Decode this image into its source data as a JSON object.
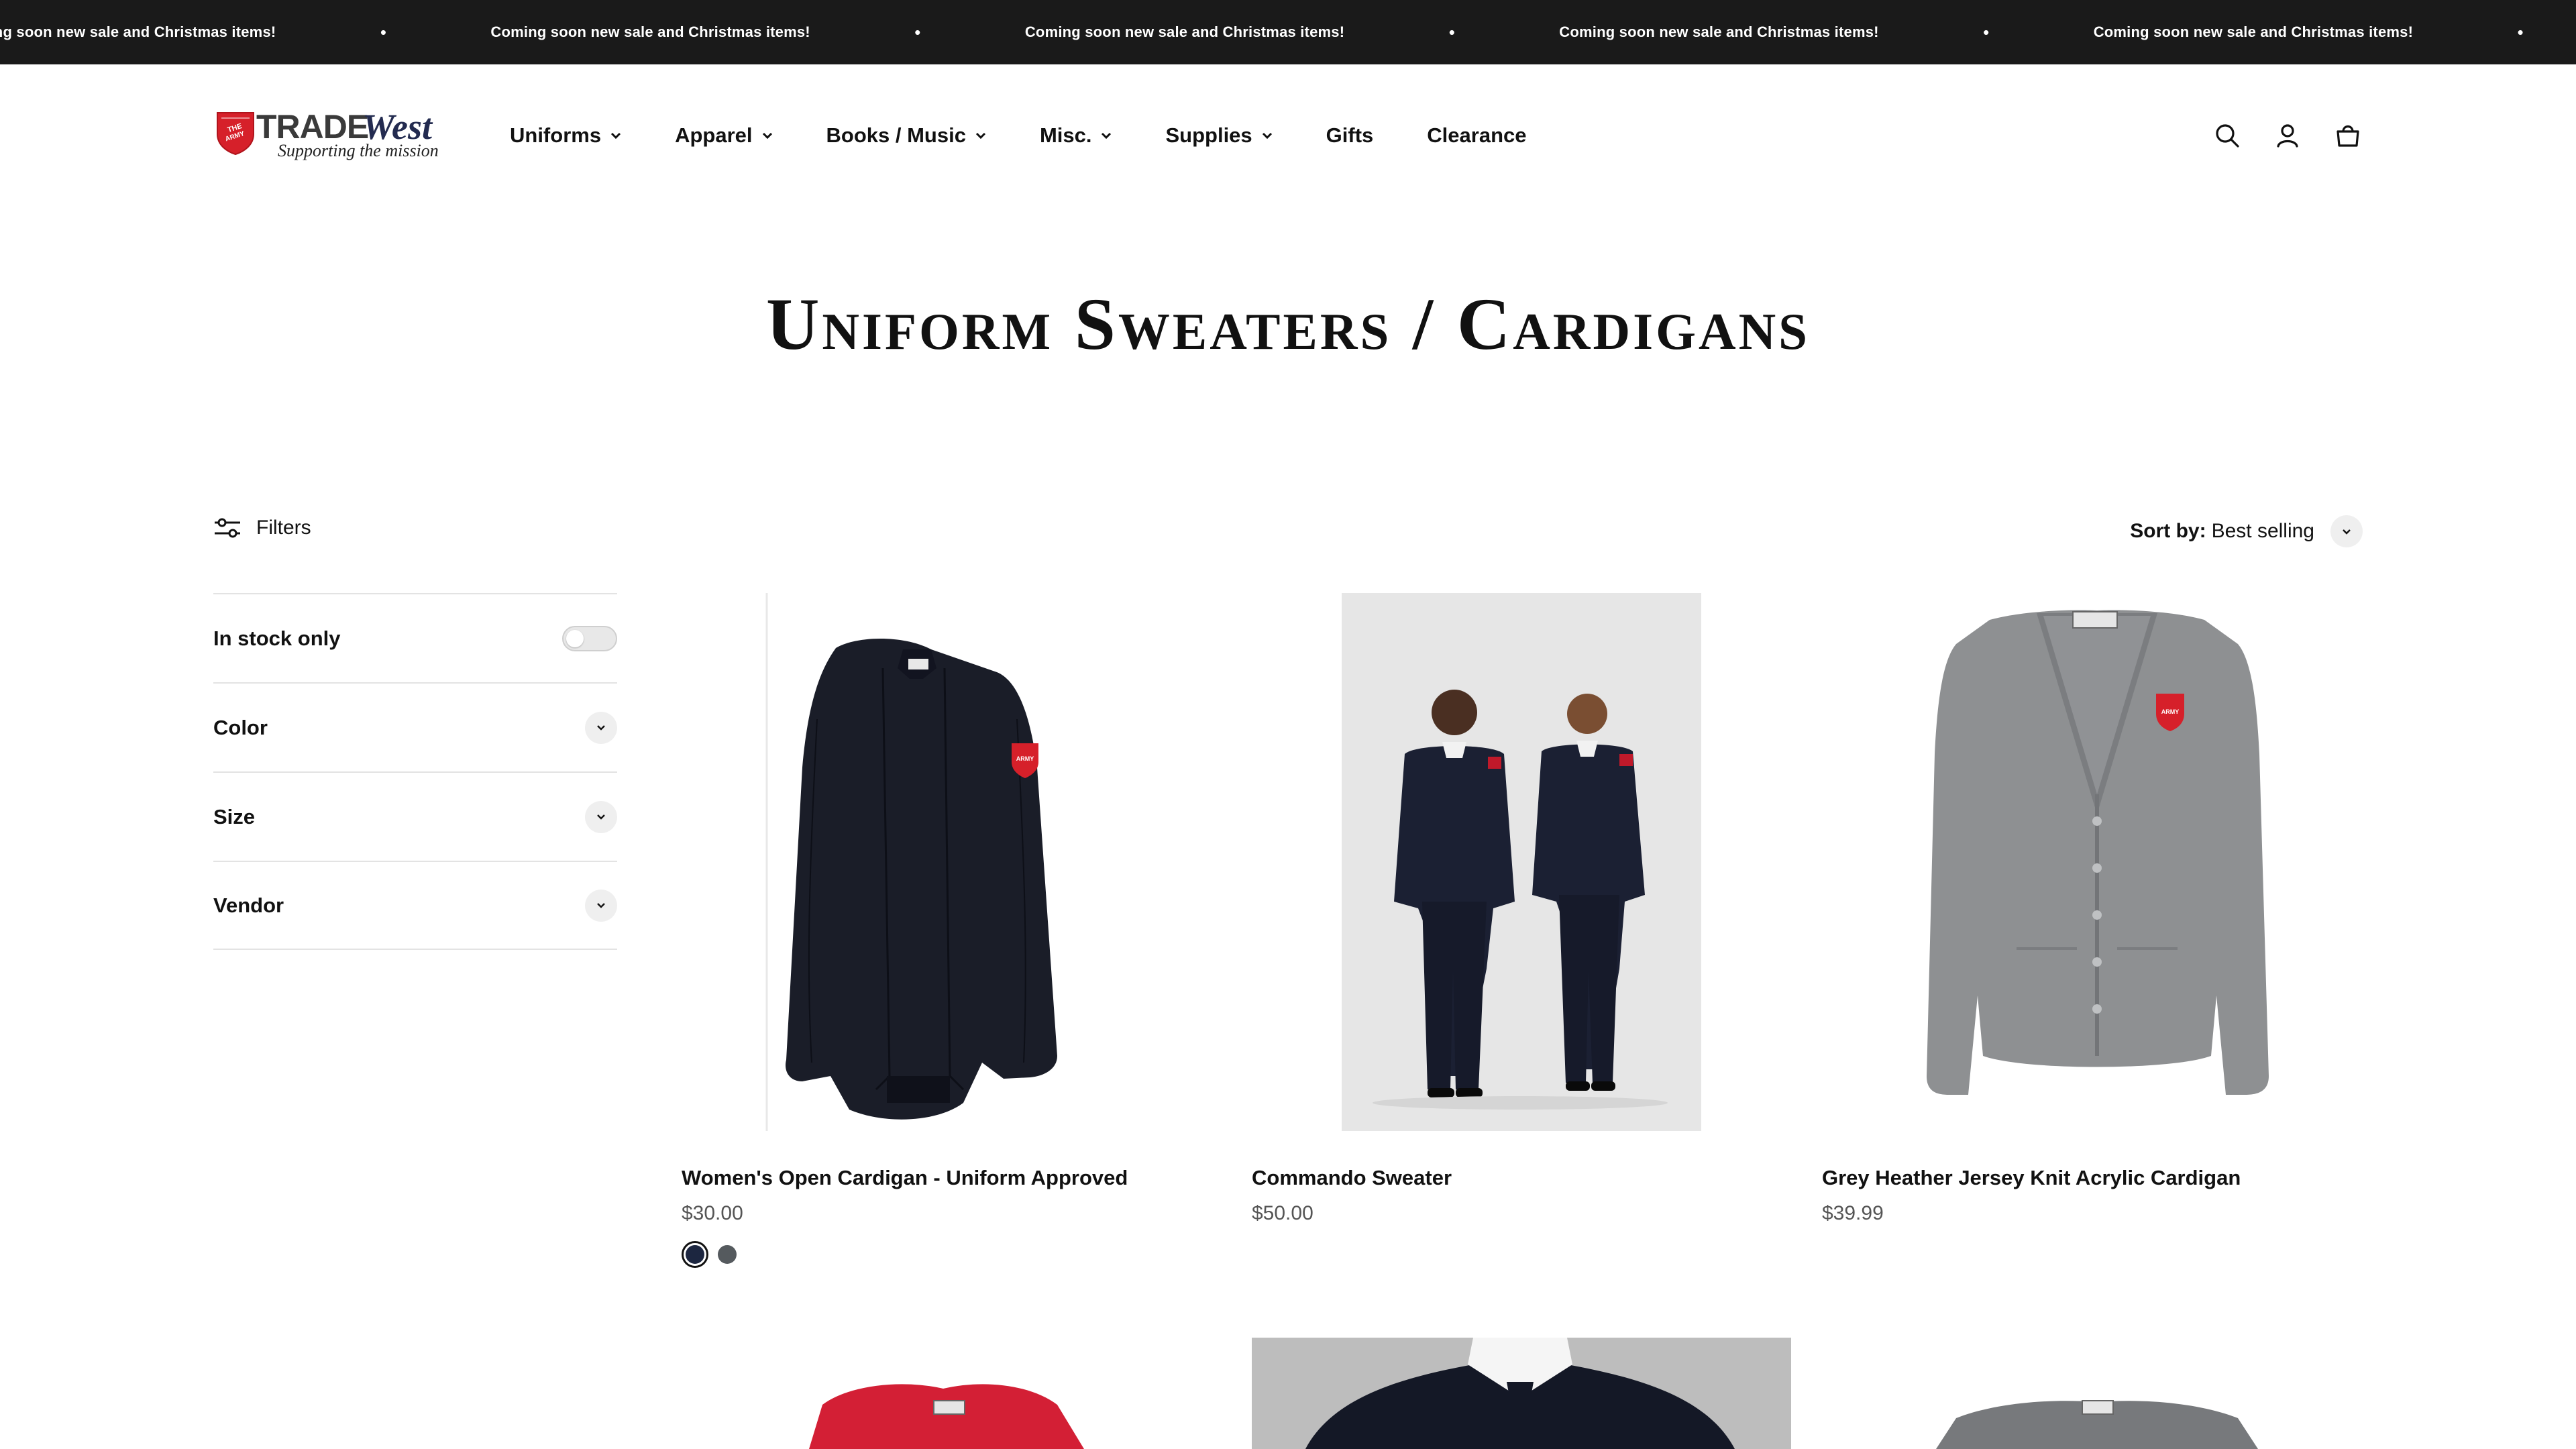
{
  "announcement": {
    "text": "Coming soon new sale and Christmas items!",
    "repeat": [
      "Coming soon new sale and Christmas items!",
      "Coming soon new sale and Christmas items!",
      "Coming soon new sale and Christmas items!",
      "Coming soon new sale and Christmas items!",
      "Coming soon new sale and Christmas items!"
    ]
  },
  "logo": {
    "brand_primary": "TRADE",
    "brand_secondary": "West",
    "tagline": "Supporting the mission"
  },
  "nav": {
    "items": [
      {
        "label": "Uniforms",
        "dropdown": true
      },
      {
        "label": "Apparel",
        "dropdown": true
      },
      {
        "label": "Books / Music",
        "dropdown": true
      },
      {
        "label": "Misc.",
        "dropdown": true
      },
      {
        "label": "Supplies",
        "dropdown": true
      },
      {
        "label": "Gifts",
        "dropdown": false
      },
      {
        "label": "Clearance",
        "dropdown": false
      }
    ]
  },
  "header_icons": [
    "search-icon",
    "account-icon",
    "cart-icon"
  ],
  "page": {
    "title": "Uniform Sweaters / Cardigans"
  },
  "toolbar": {
    "filters_label": "Filters",
    "sort_label": "Sort by:",
    "sort_value": "Best selling"
  },
  "filters": {
    "in_stock_label": "In stock only",
    "in_stock_enabled": false,
    "groups": [
      "Color",
      "Size",
      "Vendor"
    ]
  },
  "products": [
    {
      "name": "Women's Open Cardigan - Uniform Approved",
      "price": "$30.00",
      "swatches": [
        "#1c2640",
        "#555a5e"
      ],
      "selected_swatch": 0
    },
    {
      "name": "Commando Sweater",
      "price": "$50.00",
      "swatches": []
    },
    {
      "name": "Grey Heather Jersey Knit Acrylic Cardigan",
      "price": "$39.99",
      "swatches": []
    }
  ],
  "colors": {
    "announcement_bg": "#1a1a1a",
    "brand_red": "#d6202a",
    "brand_navy": "#232b50",
    "text": "#111111",
    "price": "#555555"
  }
}
